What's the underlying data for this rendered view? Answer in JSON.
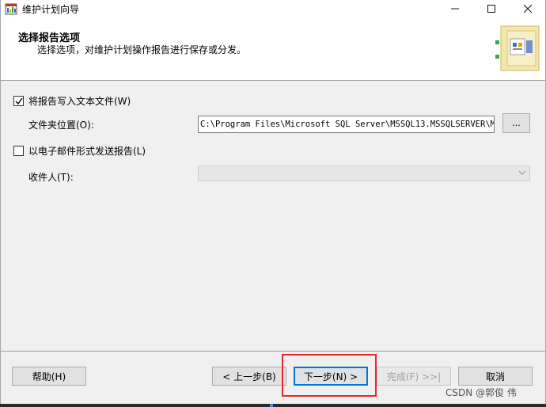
{
  "window": {
    "title": "维护计划向导"
  },
  "titlebar_buttons": {
    "minimize": "—",
    "maximize": "☐",
    "close": "✕"
  },
  "header": {
    "title": "选择报告选项",
    "subtitle": "选择选项，对维护计划操作报告进行保存或分发。"
  },
  "options": {
    "write_to_file": {
      "label": "将报告写入文本文件(W)",
      "checked": true
    },
    "folder_location": {
      "label": "文件夹位置(O):",
      "value": "C:\\Program Files\\Microsoft SQL Server\\MSSQL13.MSSQLSERVER\\MSSQ"
    },
    "browse_label": "...",
    "email_report": {
      "label": "以电子邮件形式发送报告(L)",
      "checked": false
    },
    "recipient": {
      "label": "收件人(T):",
      "value": ""
    }
  },
  "buttons": {
    "help": "帮助(H)",
    "back": "< 上一步(B)",
    "next": "下一步(N) >",
    "finish": "完成(F) >>|",
    "cancel": "取消"
  },
  "watermark": "CSDN @郭俊 伟",
  "colors": {
    "highlight": "#e8272a",
    "focus": "#0078d7"
  }
}
